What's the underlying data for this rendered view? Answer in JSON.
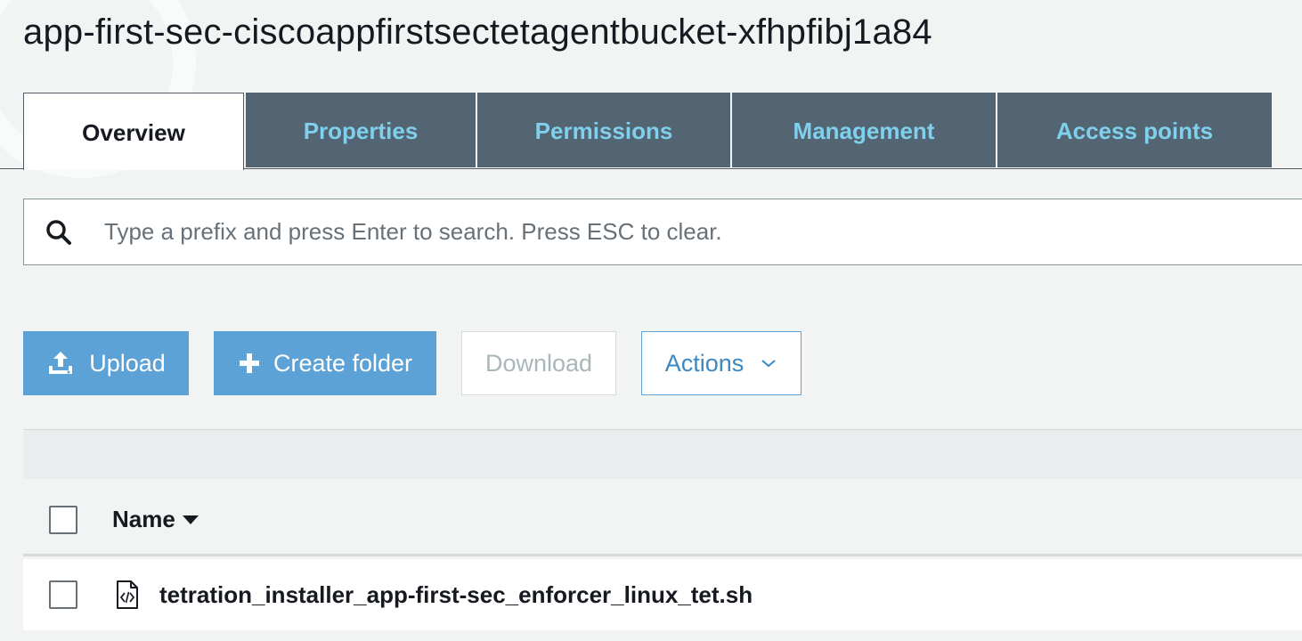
{
  "bucket": {
    "title": "app-first-sec-ciscoappfirstsectetagentbucket-xfhpfibj1a84"
  },
  "tabs": [
    {
      "label": "Overview",
      "active": true
    },
    {
      "label": "Properties",
      "active": false
    },
    {
      "label": "Permissions",
      "active": false
    },
    {
      "label": "Management",
      "active": false
    },
    {
      "label": "Access points",
      "active": false
    }
  ],
  "search": {
    "placeholder": "Type a prefix and press Enter to search. Press ESC to clear.",
    "value": "",
    "icon": "search-icon"
  },
  "toolbar": {
    "upload_label": "Upload",
    "create_folder_label": "Create folder",
    "download_label": "Download",
    "actions_label": "Actions"
  },
  "table": {
    "columns": [
      {
        "label": "Name",
        "sort": "descending"
      }
    ],
    "rows": [
      {
        "name": "tetration_installer_app-first-sec_enforcer_linux_tet.sh",
        "icon": "script-file-icon"
      }
    ]
  },
  "colors": {
    "tab_inactive_bg": "#536473",
    "tab_inactive_text": "#7fd0ec",
    "primary_button": "#5da2d6",
    "link_blue": "#3b88c3"
  }
}
